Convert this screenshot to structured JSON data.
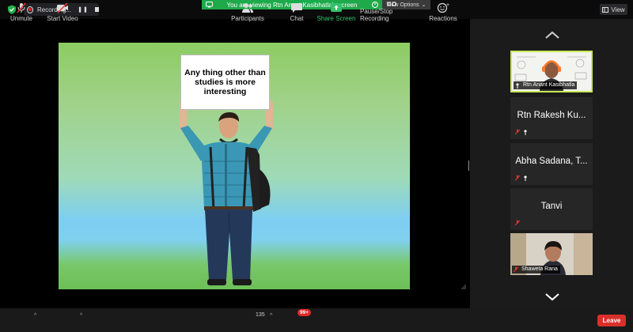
{
  "recording": {
    "label": "Recording...",
    "pause_glyph": "❚❚"
  },
  "banner": {
    "text": "You are viewing Rtn Anant Kasibhatla's screen"
  },
  "view_options": {
    "label": "View Options",
    "caret": "⌄"
  },
  "view_button": {
    "label": "View"
  },
  "slide": {
    "sign_text": "Any thing other than studies is more interesting"
  },
  "participants_panel": {
    "tiles": [
      {
        "name": "Rtn Anant Kasibhatla",
        "type": "video",
        "active": true
      },
      {
        "name": "Rtn Rakesh Ku...",
        "type": "name",
        "muted": true
      },
      {
        "name": "Abha Sadana, T...",
        "type": "name",
        "muted": true
      },
      {
        "name": "Tanvi",
        "type": "name",
        "muted": true
      },
      {
        "name": "Shaweta Rana",
        "type": "video",
        "muted": true
      }
    ]
  },
  "toolbar": {
    "unmute": {
      "label": "Unmute",
      "icon": "mic-off-icon"
    },
    "start_video": {
      "label": "Start Video",
      "icon": "video-off-icon"
    },
    "participants": {
      "label": "Participants",
      "count": "135",
      "icon": "participants-icon"
    },
    "chat": {
      "label": "Chat",
      "badge": "99+",
      "icon": "chat-icon"
    },
    "share_screen": {
      "label": "Share Screen",
      "icon": "share-screen-icon"
    },
    "pause_recording": {
      "label": "Pause/Stop Recording",
      "icon": "pause-stop-icon"
    },
    "reactions": {
      "label": "Reactions",
      "icon": "reactions-icon"
    },
    "leave": {
      "label": "Leave"
    }
  },
  "colors": {
    "share_green": "#1ea94a",
    "active_border": "#c7e854",
    "leave_red": "#d8302a",
    "badge_red": "#e02828"
  }
}
